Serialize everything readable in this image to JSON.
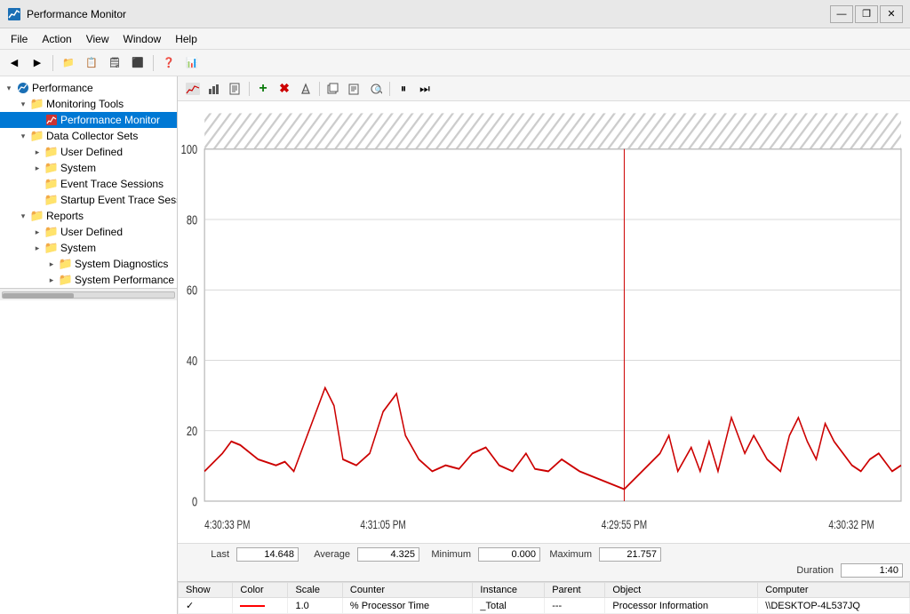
{
  "titleBar": {
    "title": "Performance Monitor",
    "btnMinimize": "—",
    "btnRestore": "❐",
    "btnClose": "✕"
  },
  "menuBar": {
    "items": [
      "File",
      "Action",
      "View",
      "Window",
      "Help"
    ]
  },
  "sidebar": {
    "root": "Performance",
    "tree": [
      {
        "id": "monitoring-tools",
        "label": "Monitoring Tools",
        "indent": 1,
        "expand": "▾",
        "icon": "folder",
        "type": "folder"
      },
      {
        "id": "performance-monitor",
        "label": "Performance Monitor",
        "indent": 2,
        "icon": "chart",
        "selected": true
      },
      {
        "id": "data-collector-sets",
        "label": "Data Collector Sets",
        "indent": 1,
        "expand": "▾",
        "icon": "folder",
        "type": "folder"
      },
      {
        "id": "user-defined-1",
        "label": "User Defined",
        "indent": 2,
        "expand": "▸",
        "icon": "folder"
      },
      {
        "id": "system-1",
        "label": "System",
        "indent": 2,
        "expand": "▸",
        "icon": "folder"
      },
      {
        "id": "event-trace-sessions",
        "label": "Event Trace Sessions",
        "indent": 2,
        "icon": "folder"
      },
      {
        "id": "startup-event-trace",
        "label": "Startup Event Trace Sess",
        "indent": 2,
        "icon": "folder"
      },
      {
        "id": "reports",
        "label": "Reports",
        "indent": 1,
        "expand": "▾",
        "icon": "folder"
      },
      {
        "id": "user-defined-2",
        "label": "User Defined",
        "indent": 2,
        "expand": "▸",
        "icon": "folder"
      },
      {
        "id": "system-2",
        "label": "System",
        "indent": 2,
        "expand": "▸",
        "icon": "folder"
      },
      {
        "id": "system-diagnostics",
        "label": "System Diagnostics",
        "indent": 3,
        "expand": "▸",
        "icon": "folder"
      },
      {
        "id": "system-performance",
        "label": "System Performance",
        "indent": 3,
        "expand": "▸",
        "icon": "folder"
      }
    ]
  },
  "perfToolbar": {
    "buttons": [
      "📊",
      "🔄",
      "📋",
      "➕",
      "✖",
      "✏",
      "📄",
      "📋",
      "📋",
      "🔍",
      "⏸",
      "⏭"
    ]
  },
  "chart": {
    "yAxis": [
      100,
      80,
      60,
      40,
      20,
      0
    ],
    "xAxis": [
      "4:30:33 PM",
      "4:31:05 PM",
      "4:29:55 PM",
      "4:30:32 PM"
    ],
    "lineColor": "#cc0000"
  },
  "stats": {
    "lastLabel": "Last",
    "lastValue": "14.648",
    "averageLabel": "Average",
    "averageValue": "4.325",
    "minimumLabel": "Minimum",
    "minimumValue": "0.000",
    "maximumLabel": "Maximum",
    "maximumValue": "21.757",
    "durationLabel": "Duration",
    "durationValue": "1:40"
  },
  "tableHeaders": [
    "Show",
    "Color",
    "Scale",
    "Counter",
    "Instance",
    "Parent",
    "Object",
    "Computer"
  ],
  "tableRows": [
    {
      "show": "✓",
      "colorLine": true,
      "scale": "1.0",
      "counter": "% Processor Time",
      "instance": "_Total",
      "parent": "---",
      "object": "Processor Information",
      "computer": "\\\\DESKTOP-4L537JQ"
    }
  ]
}
